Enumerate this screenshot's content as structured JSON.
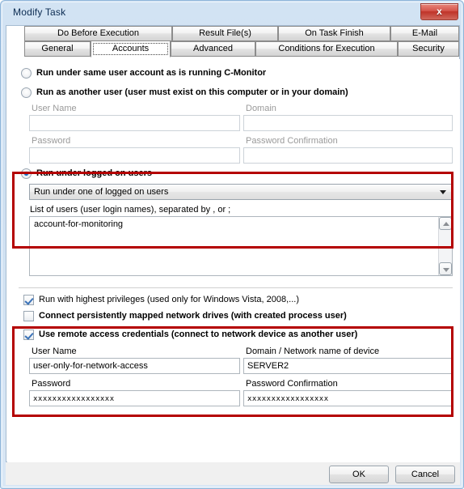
{
  "window": {
    "title": "Modify Task",
    "close_label": "x"
  },
  "tabs": {
    "row1": [
      {
        "label": "Do Before Execution",
        "selected": false
      },
      {
        "label": "Result File(s)",
        "selected": false
      },
      {
        "label": "On Task Finish",
        "selected": false
      },
      {
        "label": "E-Mail",
        "selected": false
      }
    ],
    "row2": [
      {
        "label": "General",
        "selected": false
      },
      {
        "label": "Accounts",
        "selected": true
      },
      {
        "label": "Advanced",
        "selected": false
      },
      {
        "label": "Conditions for Execution",
        "selected": false
      },
      {
        "label": "Security",
        "selected": false
      }
    ]
  },
  "accounts": {
    "run_mode": {
      "option_same_user": "Run under same user account as is running C-Monitor",
      "option_another_user": "Run as another user  (user must exist on this computer or in your domain)",
      "option_logged_on_users": "Run under logged on users",
      "selected": "logged_on_users"
    },
    "another_user": {
      "user_name_label": "User Name",
      "user_name_value": "",
      "domain_label": "Domain",
      "domain_value": "",
      "password_label": "Password",
      "password_value": "",
      "password_confirmation_label": "Password Confirmation",
      "password_confirmation_value": ""
    },
    "logged_on": {
      "combo_value": "Run under one of logged on users",
      "list_label": "List of users (user login names), separated by , or ;",
      "list_value": "account-for-monitoring"
    },
    "options": [
      {
        "label": "Run with highest privileges (used only for Windows Vista, 2008,...)",
        "checked": true,
        "bold": false
      },
      {
        "label": "Connect persistently mapped network drives  (with created process user)",
        "checked": false,
        "bold": true
      },
      {
        "label": "Use remote access credentials  (connect to network device as another user)",
        "checked": true,
        "bold": true
      }
    ],
    "remote_access": {
      "user_name_label": "User Name",
      "user_name_value": "user-only-for-network-access",
      "domain_label": "Domain / Network name of device",
      "domain_value": "SERVER2",
      "password_label": "Password",
      "password_value": "xxxxxxxxxxxxxxxxx",
      "password_confirmation_label": "Password Confirmation",
      "password_confirmation_value": "xxxxxxxxxxxxxxxxx"
    }
  },
  "footer": {
    "ok_label": "OK",
    "cancel_label": "Cancel"
  },
  "colors": {
    "highlight_red": "#b40000",
    "accent_blue": "#1b6fc4",
    "titlebar": "#d2e3f3"
  }
}
